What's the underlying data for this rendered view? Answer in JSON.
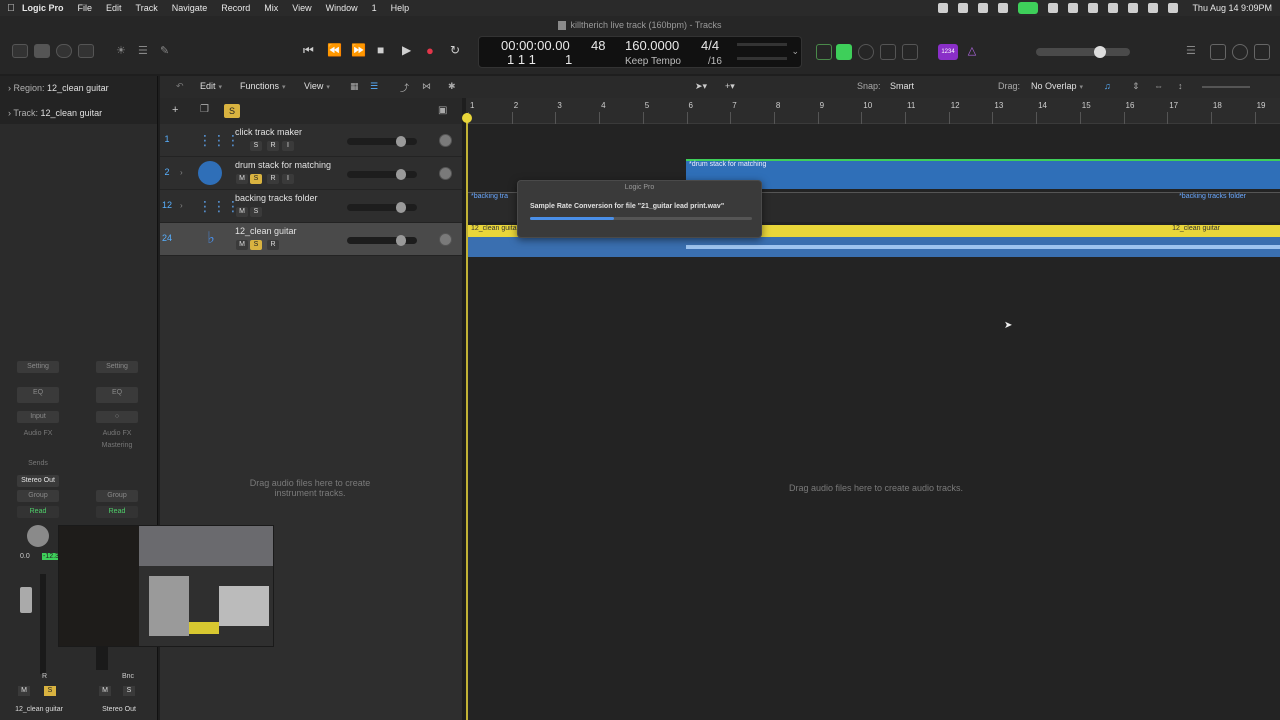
{
  "menubar": {
    "app_name": "Logic Pro",
    "menus": [
      "File",
      "Edit",
      "Track",
      "Navigate",
      "Record",
      "Mix",
      "View",
      "Window",
      "1",
      "Help"
    ],
    "clock": "Thu Aug 14  9:09PM"
  },
  "window": {
    "title": "killtherich live track (160bpm) - Tracks"
  },
  "lcd": {
    "time": "00:00:00.00",
    "bars": "1  1  1",
    "subdiv_top": "48",
    "subdiv_bottom": "1",
    "tempo": "160.0000",
    "tempo_mode": "Keep Tempo",
    "sig": "4/4",
    "division": "/16"
  },
  "badge_text": "1234",
  "inspector": {
    "region_label": "Region:",
    "region_value": "12_clean guitar",
    "track_label": "Track:",
    "track_value": "12_clean guitar",
    "strip1": {
      "setting": "Setting",
      "eq": "EQ",
      "input": "Input",
      "audio_fx": "Audio FX",
      "sends": "Sends",
      "output": "Stereo Out",
      "group": "Group",
      "automation": "Read",
      "pan_value": "0.0",
      "level_value": "-12.3",
      "name": "12_clean guitar"
    },
    "strip2": {
      "setting": "Setting",
      "eq": "EQ",
      "audio_fx": "Audio FX",
      "audio_fx_value": "Mastering",
      "group": "Group",
      "automation": "Read",
      "bounce": "Bnc",
      "name": "Stereo Out"
    }
  },
  "arrange_toolbar": {
    "edit": "Edit",
    "functions": "Functions",
    "view": "View",
    "snap_label": "Snap:",
    "snap_value": "Smart",
    "drag_label": "Drag:",
    "drag_value": "No Overlap"
  },
  "track_list_solo": "S",
  "tracks": [
    {
      "num": "1",
      "name": "click track maker",
      "buttons": [
        "S",
        "R",
        "I"
      ],
      "fader": 0.82
    },
    {
      "num": "2",
      "name": "drum stack for matching",
      "buttons": [
        "M",
        "S",
        "R",
        "I"
      ],
      "fader": 0.82
    },
    {
      "num": "12",
      "name": "backing tracks folder",
      "buttons": [
        "M",
        "S"
      ],
      "fader": 0.82
    },
    {
      "num": "24",
      "name": "12_clean guitar",
      "buttons": [
        "M",
        "S",
        "R"
      ],
      "fader": 0.82
    }
  ],
  "ruler_bars": [
    "1",
    "2",
    "3",
    "4",
    "5",
    "6",
    "7",
    "8",
    "9",
    "10",
    "11",
    "12",
    "13",
    "14",
    "15",
    "16",
    "17",
    "18",
    "19"
  ],
  "regions": {
    "drum": "*drum stack for matching",
    "backing_left": "*backing tra",
    "backing_right": "*backing tracks folder",
    "guitar_left": "12_clean guita",
    "guitar_right": "12_clean guitar"
  },
  "dialog": {
    "title": "Logic Pro",
    "message": "Sample Rate Conversion for file \"21_guitar lead print.wav\"",
    "progress": 0.38
  },
  "hints": {
    "instrument": "Drag audio files here to create instrument tracks.",
    "audio": "Drag audio files here to create audio tracks."
  },
  "colors": {
    "accent_blue": "#3a7fd6",
    "region_yellow": "#e9d63a",
    "solo_yellow": "#d9b340",
    "record_red": "#e3364a",
    "green": "#3ecf5a"
  }
}
